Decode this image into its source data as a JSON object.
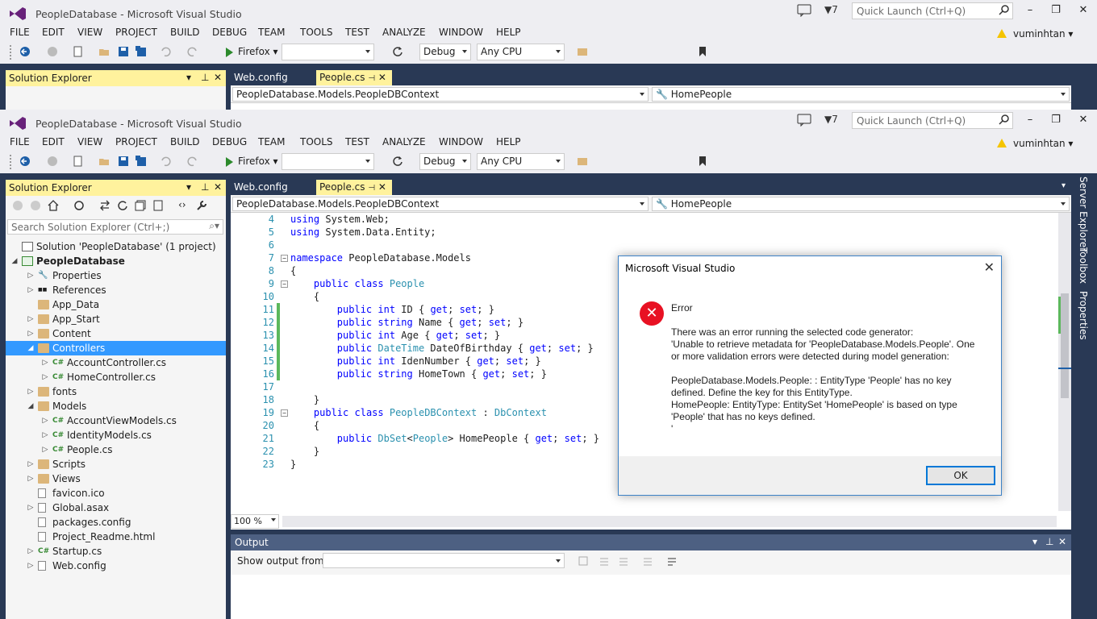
{
  "window": {
    "title": "PeopleDatabase - Microsoft Visual Studio",
    "notification_count": "7",
    "quick_launch_placeholder": "Quick Launch (Ctrl+Q)",
    "user": "vuminhtan"
  },
  "menu": [
    "FILE",
    "EDIT",
    "VIEW",
    "PROJECT",
    "BUILD",
    "DEBUG",
    "TEAM",
    "TOOLS",
    "TEST",
    "ANALYZE",
    "WINDOW",
    "HELP"
  ],
  "toolbar": {
    "run_target": "Firefox",
    "config": "Debug",
    "platform": "Any CPU"
  },
  "solution_explorer": {
    "title": "Solution Explorer",
    "search_placeholder": "Search Solution Explorer (Ctrl+;)",
    "tree": [
      {
        "label": "Solution 'PeopleDatabase' (1 project)",
        "level": 0,
        "icon": "solution-icon"
      },
      {
        "label": "PeopleDatabase",
        "level": 0,
        "icon": "project-icon",
        "bold": true
      },
      {
        "label": "Properties",
        "level": 1,
        "icon": "wrench-icon"
      },
      {
        "label": "References",
        "level": 1,
        "icon": "references-icon"
      },
      {
        "label": "App_Data",
        "level": 1,
        "icon": "folder-icon"
      },
      {
        "label": "App_Start",
        "level": 1,
        "icon": "folder-icon"
      },
      {
        "label": "Content",
        "level": 1,
        "icon": "folder-icon"
      },
      {
        "label": "Controllers",
        "level": 1,
        "icon": "folder-icon",
        "selected": true
      },
      {
        "label": "AccountController.cs",
        "level": 2,
        "icon": "csharp-icon"
      },
      {
        "label": "HomeController.cs",
        "level": 2,
        "icon": "csharp-icon"
      },
      {
        "label": "fonts",
        "level": 1,
        "icon": "folder-icon"
      },
      {
        "label": "Models",
        "level": 1,
        "icon": "folder-icon"
      },
      {
        "label": "AccountViewModels.cs",
        "level": 2,
        "icon": "csharp-icon"
      },
      {
        "label": "IdentityModels.cs",
        "level": 2,
        "icon": "csharp-icon"
      },
      {
        "label": "People.cs",
        "level": 2,
        "icon": "csharp-icon"
      },
      {
        "label": "Scripts",
        "level": 1,
        "icon": "folder-icon"
      },
      {
        "label": "Views",
        "level": 1,
        "icon": "folder-icon"
      },
      {
        "label": "favicon.ico",
        "level": 1,
        "icon": "file-icon"
      },
      {
        "label": "Global.asax",
        "level": 1,
        "icon": "file-icon"
      },
      {
        "label": "packages.config",
        "level": 1,
        "icon": "file-icon"
      },
      {
        "label": "Project_Readme.html",
        "level": 1,
        "icon": "file-icon"
      },
      {
        "label": "Startup.cs",
        "level": 1,
        "icon": "csharp-icon"
      },
      {
        "label": "Web.config",
        "level": 1,
        "icon": "file-icon"
      }
    ]
  },
  "tabs": [
    "Web.config",
    "People.cs"
  ],
  "editor": {
    "nav_left": "PeopleDatabase.Models.PeopleDBContext",
    "nav_right": "HomePeople",
    "zoom": "100 %",
    "lines": [
      {
        "n": "4",
        "t": "using System.Web;"
      },
      {
        "n": "5",
        "t": "using System.Data.Entity;"
      },
      {
        "n": "6",
        "t": ""
      },
      {
        "n": "7",
        "t": "namespace PeopleDatabase.Models"
      },
      {
        "n": "8",
        "t": "{"
      },
      {
        "n": "9",
        "t": "    public class People"
      },
      {
        "n": "10",
        "t": "    {"
      },
      {
        "n": "11",
        "t": "        public int ID { get; set; }"
      },
      {
        "n": "12",
        "t": "        public string Name { get; set; }"
      },
      {
        "n": "13",
        "t": "        public int Age { get; set; }"
      },
      {
        "n": "14",
        "t": "        public DateTime DateOfBirthday { get; set; }"
      },
      {
        "n": "15",
        "t": "        public int IdenNumber { get; set; }"
      },
      {
        "n": "16",
        "t": "        public string HomeTown { get; set; }"
      },
      {
        "n": "17",
        "t": ""
      },
      {
        "n": "18",
        "t": "    }"
      },
      {
        "n": "19",
        "t": "    public class PeopleDBContext : DbContext"
      },
      {
        "n": "20",
        "t": "    {"
      },
      {
        "n": "21",
        "t": "        public DbSet<People> HomePeople { get; set; }"
      },
      {
        "n": "22",
        "t": "    }"
      },
      {
        "n": "23",
        "t": "}"
      }
    ]
  },
  "output": {
    "title": "Output",
    "show_from_label": "Show output from:"
  },
  "side_tabs": [
    "Server Explorer",
    "Toolbox",
    "Properties"
  ],
  "dialog": {
    "title": "Microsoft Visual Studio",
    "heading": "Error",
    "message": "There was an error running the selected code generator:\n'Unable to retrieve metadata for 'PeopleDatabase.Models.People'. One or more validation errors were detected during model generation:\n\nPeopleDatabase.Models.People: : EntityType 'People' has no key defined. Define the key for this EntityType.\nHomePeople: EntityType: EntitySet 'HomePeople' is based on type 'People' that has no keys defined.\n'",
    "ok_label": "OK"
  },
  "colors": {
    "accent": "#fff29d",
    "dock": "#293955",
    "selection": "#3399ff",
    "keyword": "#0000ff",
    "type": "#2b91af",
    "error": "#e81123"
  }
}
